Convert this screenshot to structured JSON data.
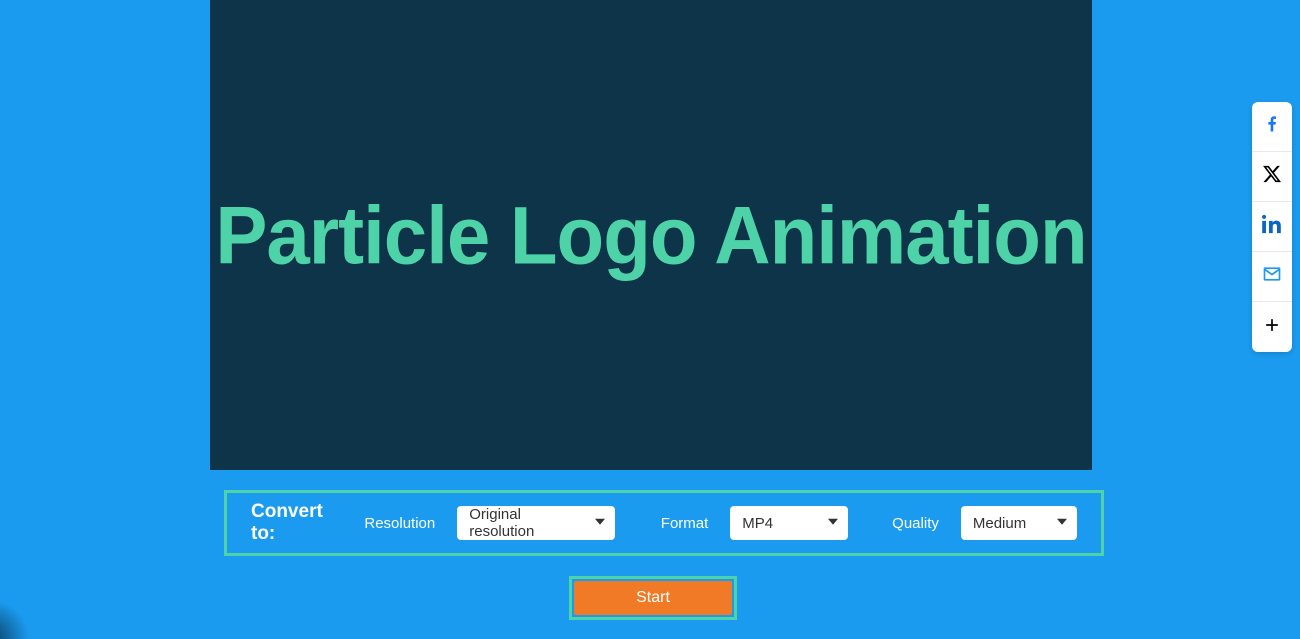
{
  "preview": {
    "title": "Particle Logo Animation"
  },
  "convert": {
    "heading": "Convert to:",
    "resolution_label": "Resolution",
    "resolution_value": "Original resolution",
    "format_label": "Format",
    "format_value": "MP4",
    "quality_label": "Quality",
    "quality_value": "Medium"
  },
  "actions": {
    "start_label": "Start"
  },
  "share": {
    "facebook": "facebook-icon",
    "x": "x-icon",
    "linkedin": "linkedin-icon",
    "email": "email-icon",
    "more": "plus-icon"
  },
  "colors": {
    "page_bg": "#1a9bf0",
    "preview_bg": "#0d3449",
    "accent": "#4ed3a8",
    "button": "#f07a26"
  }
}
